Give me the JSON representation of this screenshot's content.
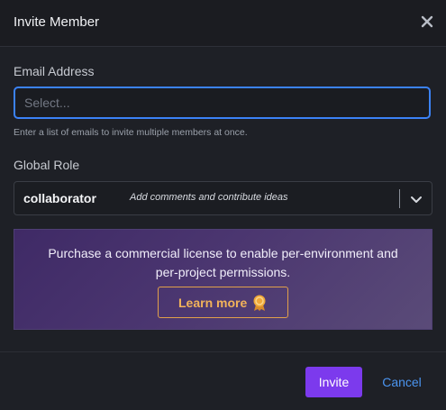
{
  "modal": {
    "title": "Invite Member",
    "close_icon": "close-icon"
  },
  "email": {
    "label": "Email Address",
    "placeholder": "Select...",
    "value": "",
    "hint": "Enter a list of emails to invite multiple members at once."
  },
  "role": {
    "label": "Global Role",
    "selected": "collaborator",
    "description": "Add comments and contribute ideas",
    "chevron_icon": "chevron-down-icon"
  },
  "banner": {
    "message_line1": "Purchase a commercial license to enable per-environment and",
    "message_line2": "per-project permissions.",
    "learn_more_label": "Learn more",
    "learn_more_icon": "award-icon"
  },
  "footer": {
    "invite_label": "Invite",
    "cancel_label": "Cancel"
  },
  "colors": {
    "accent": "#7c3aed",
    "focus_border": "#3b82f6",
    "link": "#4b95f0",
    "banner_cta": "#f2b35a"
  }
}
